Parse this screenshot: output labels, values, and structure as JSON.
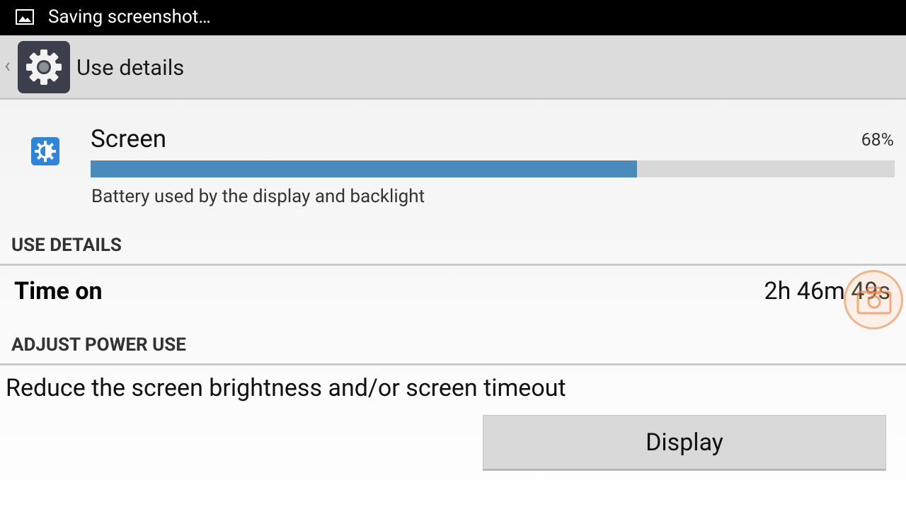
{
  "status_bar": {
    "notification_icon": "image-icon",
    "text": "Saving screenshot…"
  },
  "action_bar": {
    "app_icon": "settings-gear-icon",
    "title": "Use details"
  },
  "usage": {
    "icon": "brightness-icon",
    "name": "Screen",
    "percent_text": "68%",
    "percent_value": 68,
    "description": "Battery used by the display and backlight",
    "bar_color": "#4a8bbd"
  },
  "use_details": {
    "header": "USE DETAILS",
    "time_on_label": "Time on",
    "time_on_value": "2h 46m 49s"
  },
  "adjust": {
    "header": "ADJUST POWER USE",
    "advice": "Reduce the screen brightness and/or screen timeout",
    "button_label": "Display"
  }
}
